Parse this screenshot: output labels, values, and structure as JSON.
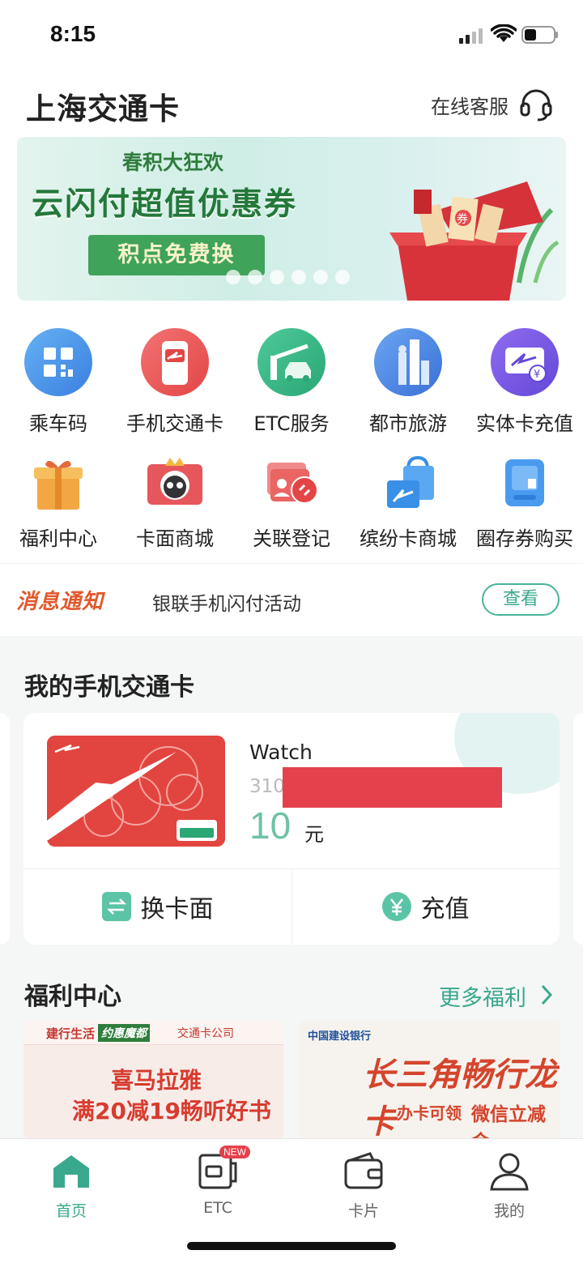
{
  "status": {
    "time": "8:15"
  },
  "header": {
    "title": "上海交通卡",
    "service_label": "在线客服"
  },
  "banner": {
    "subtitle": "春积大狂欢",
    "headline": "云闪付超值优惠券",
    "cta": "积点免费换",
    "gift_text": "券"
  },
  "grid": {
    "row1": [
      "乘车码",
      "手机交通卡",
      "ETC服务",
      "都市旅游",
      "实体卡充值"
    ],
    "row2": [
      "福利中心",
      "卡面商城",
      "关联登记",
      "缤纷卡商城",
      "圈存券购买"
    ]
  },
  "notice": {
    "tag": "消息通知",
    "message": "银联手机闪付活动",
    "button": "查看"
  },
  "my_cards": {
    "title": "我的手机交通卡",
    "card": {
      "name": "Watch",
      "number_prefix": "310",
      "balance": "10",
      "unit": "元"
    },
    "actions": {
      "change_face": "换卡面",
      "recharge": "充值"
    }
  },
  "welfare": {
    "title": "福利中心",
    "more": "更多福利",
    "promo1": {
      "brand1": "建行生活",
      "brand2": "约惠魔都",
      "brand3": "交通卡公司",
      "line1": "喜马拉雅",
      "line2": "满20减19畅听好书"
    },
    "promo2": {
      "bank": "中国建设银行",
      "line1": "长三角畅行龙卡",
      "line2": "办卡可领",
      "line3": "微信立减金"
    }
  },
  "tabs": {
    "home": "首页",
    "etc": "ETC",
    "etc_badge": "NEW",
    "cards": "卡片",
    "mine": "我的"
  },
  "colors": {
    "accent": "#3aa88d",
    "notice_tag": "#e2582c",
    "card_red": "#e2453f"
  }
}
